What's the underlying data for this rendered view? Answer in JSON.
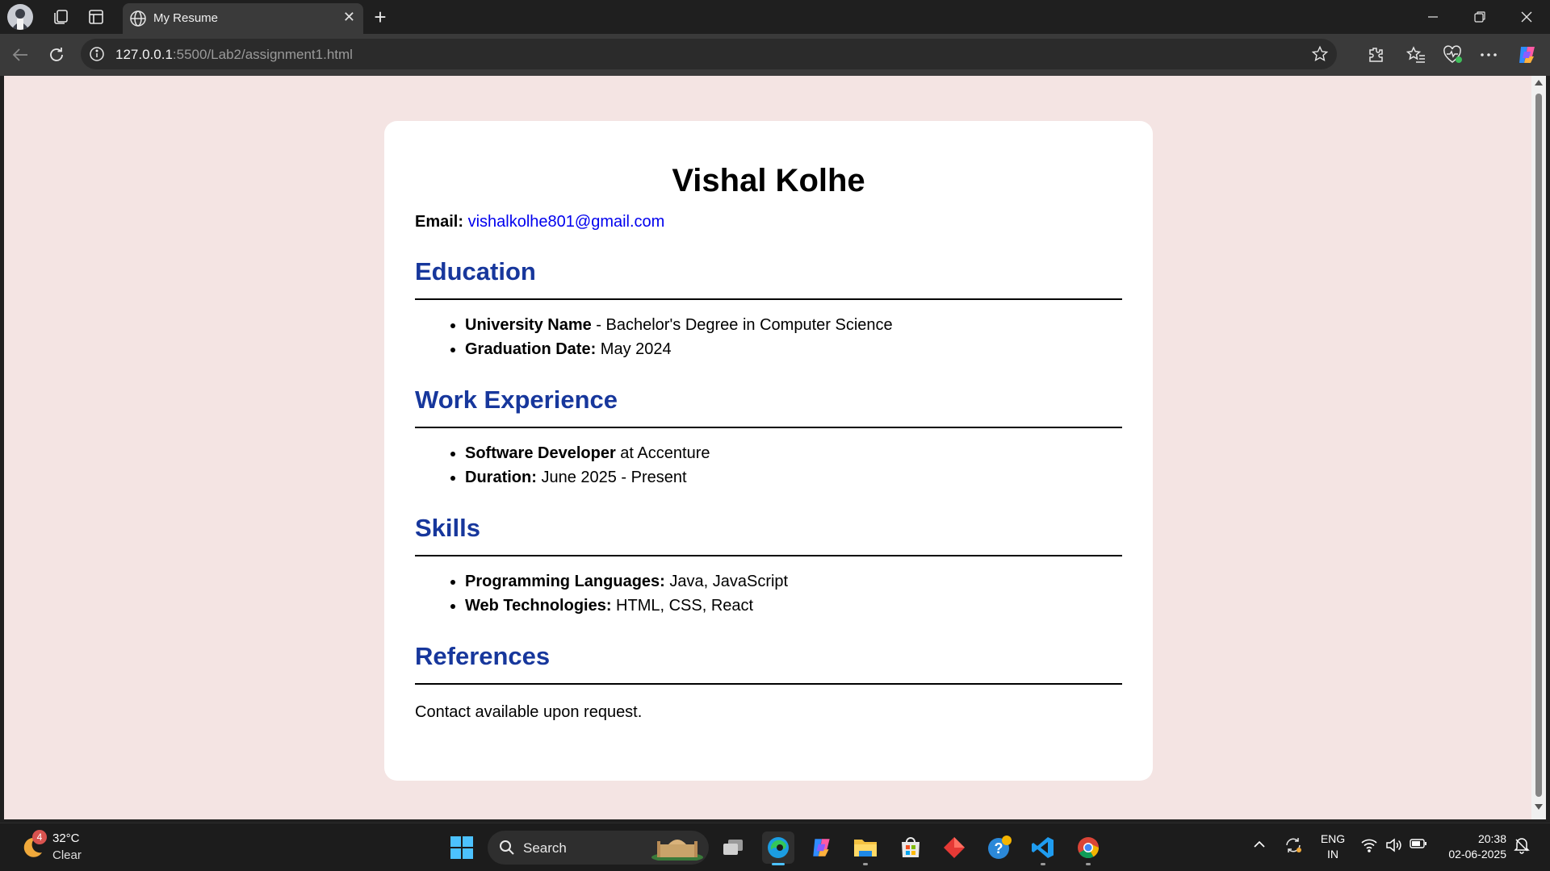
{
  "browser": {
    "tab_title": "My Resume",
    "url_host": "127.0.0.1",
    "url_rest": ":5500/Lab2/assignment1.html"
  },
  "resume": {
    "name": "Vishal Kolhe",
    "email_label": "Email:",
    "email": "vishalkolhe801@gmail.com",
    "sections": {
      "education": {
        "title": "Education",
        "items": [
          {
            "label": "University Name",
            "text": " - Bachelor's Degree in Computer Science"
          },
          {
            "label": "Graduation Date:",
            "text": " May 2024"
          }
        ]
      },
      "work": {
        "title": "Work Experience",
        "items": [
          {
            "label": "Software Developer",
            "text": " at Accenture"
          },
          {
            "label": "Duration:",
            "text": " June 2025 - Present"
          }
        ]
      },
      "skills": {
        "title": "Skills",
        "items": [
          {
            "label": "Programming Languages:",
            "text": " Java, JavaScript"
          },
          {
            "label": "Web Technologies:",
            "text": " HTML, CSS, React"
          }
        ]
      },
      "references": {
        "title": "References",
        "text": "Contact available upon request."
      }
    }
  },
  "taskbar": {
    "weather_badge": "4",
    "weather_temp": "32°C",
    "weather_condition": "Clear",
    "search_label": "Search",
    "lang_line1": "ENG",
    "lang_line2": "IN",
    "time": "20:38",
    "date": "02-06-2025"
  }
}
